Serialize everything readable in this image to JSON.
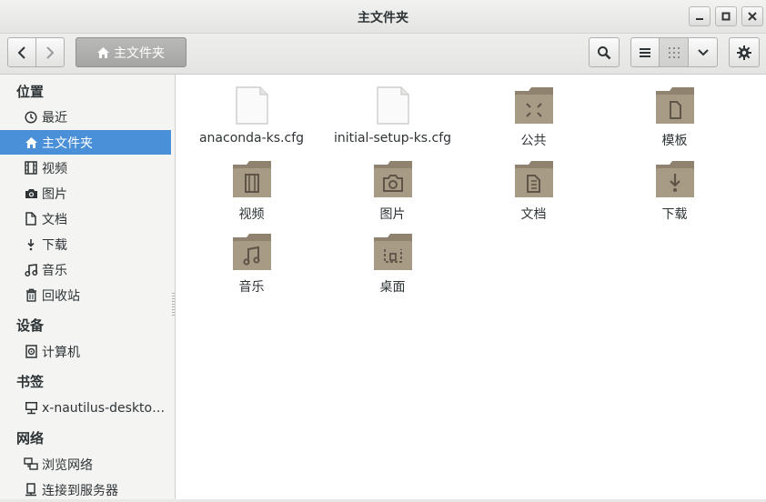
{
  "window": {
    "title": "主文件夹"
  },
  "toolbar": {
    "location_label": "主文件夹"
  },
  "sidebar": {
    "places_header": "位置",
    "places": [
      {
        "label": "最近",
        "icon": "clock-icon"
      },
      {
        "label": "主文件夹",
        "icon": "home-icon",
        "selected": true
      },
      {
        "label": "视频",
        "icon": "film-icon"
      },
      {
        "label": "图片",
        "icon": "camera-icon"
      },
      {
        "label": "文档",
        "icon": "document-icon"
      },
      {
        "label": "下载",
        "icon": "download-icon"
      },
      {
        "label": "音乐",
        "icon": "music-icon"
      },
      {
        "label": "回收站",
        "icon": "trash-icon"
      }
    ],
    "devices_header": "设备",
    "devices": [
      {
        "label": "计算机",
        "icon": "computer-icon"
      }
    ],
    "bookmarks_header": "书签",
    "bookmarks": [
      {
        "label": "x-nautilus-deskto…",
        "icon": "network-folder-icon"
      }
    ],
    "network_header": "网络",
    "network": [
      {
        "label": "浏览网络",
        "icon": "network-icon"
      },
      {
        "label": "连接到服务器",
        "icon": "server-icon"
      }
    ]
  },
  "files": [
    {
      "name": "anaconda-ks.cfg",
      "type": "file"
    },
    {
      "name": "initial-setup-ks.cfg",
      "type": "file"
    },
    {
      "name": "公共",
      "type": "folder",
      "emblem": "share"
    },
    {
      "name": "模板",
      "type": "folder",
      "emblem": "template"
    },
    {
      "name": "视频",
      "type": "folder",
      "emblem": "film"
    },
    {
      "name": "图片",
      "type": "folder",
      "emblem": "camera"
    },
    {
      "name": "文档",
      "type": "folder",
      "emblem": "document"
    },
    {
      "name": "下载",
      "type": "folder",
      "emblem": "download"
    },
    {
      "name": "音乐",
      "type": "folder",
      "emblem": "music"
    },
    {
      "name": "桌面",
      "type": "folder",
      "emblem": "desktop"
    }
  ],
  "colors": {
    "selection": "#4a90d9",
    "folder": "#a79a85"
  }
}
